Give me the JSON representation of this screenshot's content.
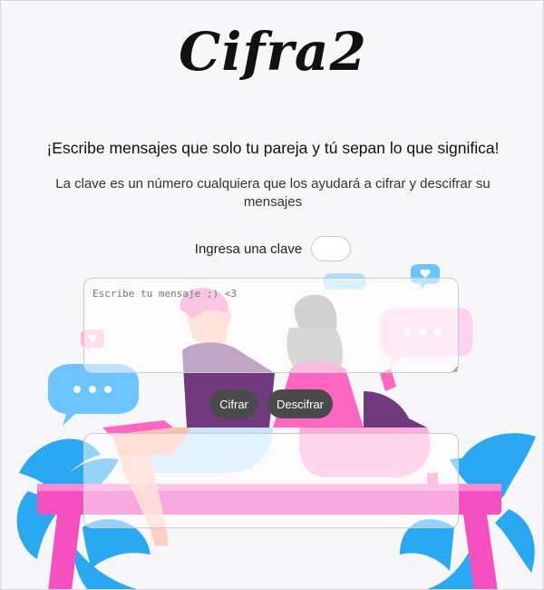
{
  "app": {
    "logo_text": "Cifra2"
  },
  "headline": "¡Escribe mensajes que solo tu pareja y tú sepan lo que significa!",
  "subtext": "La clave es un número cualquiera que los ayudará a cifrar y descifrar su mensajes",
  "key_field": {
    "label": "Ingresa una clave",
    "value": ""
  },
  "message_input": {
    "placeholder": "Escribe tu mensaje ;) <3",
    "value": ""
  },
  "buttons": {
    "encrypt": "Cifrar",
    "decrypt": "Descifrar"
  },
  "output": {
    "value": ""
  },
  "colors": {
    "accent_pink": "#ff4fb8",
    "bench_pink": "#f550c0",
    "leaf_blue": "#2aa8f2",
    "button_bg": "#4a4a4a",
    "hair_gray": "#9a9a9a",
    "shirt_purple": "#5a1a6a"
  },
  "illustration": {
    "subject": "couple sitting back-to-back on a pink bench with phones, chat bubbles and leaves"
  }
}
